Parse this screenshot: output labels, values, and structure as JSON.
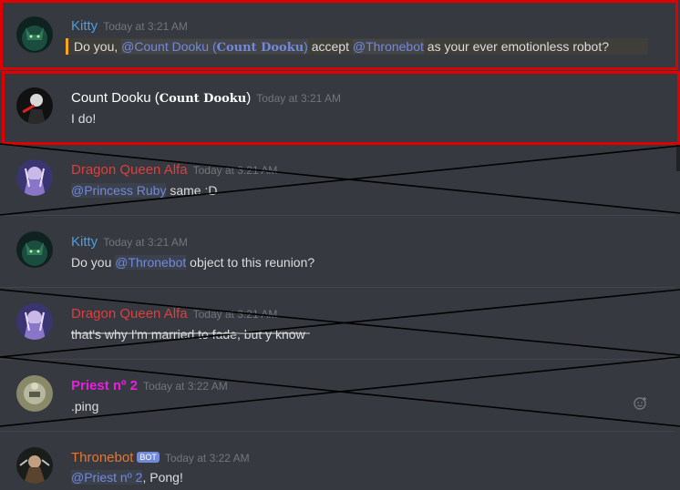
{
  "colors": {
    "background": "#36393f",
    "highlight": "#e00000",
    "mention": "#7289da",
    "timestamp": "#72767d"
  },
  "messages": [
    {
      "user": "Kitty",
      "user_color": "#4f9bdf",
      "time": "Today at 3:21 AM",
      "parts": [
        "Do you, ",
        "@Count Dooku (",
        "Count Dooku",
        ")",
        " accept ",
        "@Thronebot",
        " as your ever emotionless robot?"
      ]
    },
    {
      "user_prefix": "Count Dooku (",
      "user_gothic": "Count Dooku",
      "user_suffix": ")",
      "user_color": "#ffffff",
      "time": "Today at 3:21 AM",
      "text": "I do!"
    },
    {
      "user": "Dragon Queen Alfa",
      "user_color": "#e03e3e",
      "time": "Today at 3:21 AM",
      "mention": "@Princess Ruby",
      "text": " same :D"
    },
    {
      "user": "Kitty",
      "user_color": "#4f9bdf",
      "time": "Today at 3:21 AM",
      "prefix": "Do you ",
      "mention": "@Thronebot",
      "text": " object to this reunion?"
    },
    {
      "user": "Dragon Queen Alfa",
      "user_color": "#e03e3e",
      "time": "Today at 3:21 AM",
      "text": "that's why I'm married to fade, but y know"
    },
    {
      "user": "Priest nº 2",
      "user_color": "#e91ee0",
      "time": "Today at 3:22 AM",
      "text": ".ping"
    },
    {
      "user": "Thronebot",
      "user_color": "#e8762d",
      "bot_tag": "BOT",
      "time": "Today at 3:22 AM",
      "mention": "@Priest nº 2",
      "text": ", Pong!"
    }
  ],
  "icons": {
    "add_reaction": "add-reaction-icon"
  }
}
